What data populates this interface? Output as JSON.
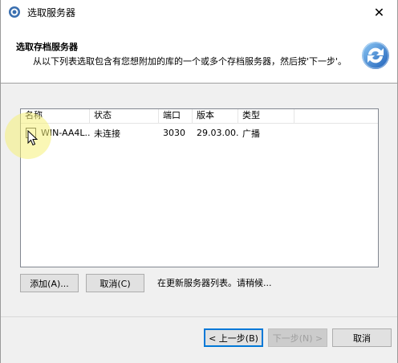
{
  "window": {
    "title": "选取服务器"
  },
  "header": {
    "title": "选取存档服务器",
    "subtitle": "从以下列表选取包含有您想附加的库的一个或多个存档服务器，然后按'下一步'。"
  },
  "list": {
    "columns": [
      "名称",
      "状态",
      "端口",
      "版本",
      "类型"
    ],
    "rows": [
      {
        "name": "WIN-AA4L...",
        "status": "未连接",
        "port": "3030",
        "version": "29.03.00...",
        "type": "广播",
        "checked": false
      }
    ]
  },
  "buttons": {
    "add": "添加(A)...",
    "cancel_refresh": "取消(C)",
    "back": "< 上一步(B)",
    "next": "下一步(N) >",
    "cancel": "取消"
  },
  "status_text": "在更新服务器列表。请稍候..."
}
